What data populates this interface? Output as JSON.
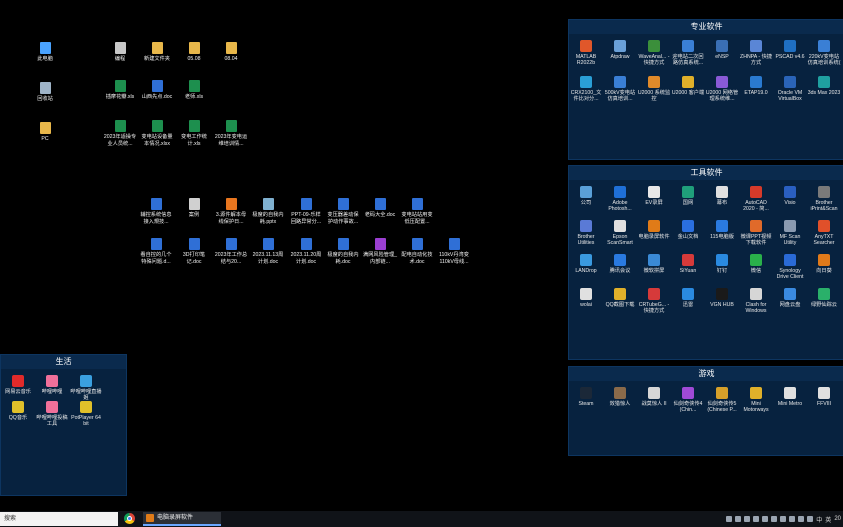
{
  "desktop_icons": [
    {
      "label": "此电脑",
      "icon": "computer-icon",
      "color": "#4aa3ff"
    },
    {
      "label": "回收站",
      "icon": "recycle-bin-icon",
      "color": "#9fb4c8"
    },
    {
      "label": "PC",
      "icon": "folder-icon",
      "color": "#e8b74a"
    },
    {
      "label": "编程",
      "icon": "shortcut-icon",
      "color": "#c8c8c8"
    },
    {
      "label": "新建文件夹",
      "icon": "folder-icon",
      "color": "#e8b74a"
    },
    {
      "label": "05.08",
      "icon": "folder-icon",
      "color": "#e8b74a"
    },
    {
      "label": "08.04",
      "icon": "folder-icon",
      "color": "#e8b74a"
    },
    {
      "label": "插摩花瓣.xls",
      "icon": "excel-icon",
      "color": "#1d8f4e"
    },
    {
      "label": "山西先点.doc",
      "icon": "word-icon",
      "color": "#2f6fd6"
    },
    {
      "label": "老师.xls",
      "icon": "excel-icon",
      "color": "#1d8f4e"
    },
    {
      "label": "2023年适操专业人员统...",
      "icon": "excel-icon",
      "color": "#1d8f4e"
    },
    {
      "label": "变电站设备量本情况.xlsx",
      "icon": "excel-icon",
      "color": "#1d8f4e"
    },
    {
      "label": "变电工作统计.xls",
      "icon": "excel-icon",
      "color": "#1d8f4e"
    },
    {
      "label": "2023年变电运维培训情...",
      "icon": "excel-icon",
      "color": "#1d8f4e"
    },
    {
      "label": "辅控系统信息接入規技...",
      "icon": "word-icon",
      "color": "#2f6fd6"
    },
    {
      "label": "案例",
      "icon": "file-icon",
      "color": "#d0d0d0"
    },
    {
      "label": "3.源件解本母线保护日...",
      "icon": "ppt-icon",
      "color": "#e8761f"
    },
    {
      "label": "极度的自我内耗.pptx",
      "icon": "image-icon",
      "color": "#7fb0d0"
    },
    {
      "label": "PPT-09-乐样回路异常分...",
      "icon": "word-icon",
      "color": "#2f6fd6"
    },
    {
      "label": "变压器差动保护动作事故...",
      "icon": "word-icon",
      "color": "#2f6fd6"
    },
    {
      "label": "老码大全.doc",
      "icon": "word-icon",
      "color": "#2f6fd6"
    },
    {
      "label": "变电站站用变低压配置...",
      "icon": "word-icon",
      "color": "#2f6fd6"
    },
    {
      "label": "看自控的几个特殊问题.d...",
      "icon": "word-icon",
      "color": "#2f6fd6"
    },
    {
      "label": "3D打印笔记.doc",
      "icon": "word-icon",
      "color": "#2f6fd6"
    },
    {
      "label": "2023年工作总结与20...",
      "icon": "word-icon",
      "color": "#2f6fd6"
    },
    {
      "label": "2023.11.13周计划.doc",
      "icon": "word-icon",
      "color": "#2f6fd6"
    },
    {
      "label": "2023.11.20周计划.doc",
      "icon": "word-icon",
      "color": "#2f6fd6"
    },
    {
      "label": "极度的自我内耗.doc",
      "icon": "word-icon",
      "color": "#2f6fd6"
    },
    {
      "label": "满网风险管理_内部链...",
      "icon": "rar-icon",
      "color": "#9b3fd1"
    },
    {
      "label": "配电自动化技术.doc",
      "icon": "word-icon",
      "color": "#2f6fd6"
    },
    {
      "label": "110kV丹湾变110kV母线...",
      "icon": "word-icon",
      "color": "#2f6fd6"
    }
  ],
  "fences": {
    "professional": {
      "title": "专业软件",
      "items": [
        {
          "label": "MATLAB R2022b",
          "icon": "matlab-icon",
          "color": "#e0572a"
        },
        {
          "label": "Atpdraw",
          "icon": "atpdraw-icon",
          "color": "#6aa0d8"
        },
        {
          "label": "WaveAnal... - 快捷方式",
          "icon": "wave-icon",
          "color": "#3b8f3b"
        },
        {
          "label": "迎电站二次回路仿真系统...",
          "icon": "mail-icon",
          "color": "#3a7fd5"
        },
        {
          "label": "eNSP",
          "icon": "ensp-icon",
          "color": "#3a6fb5"
        },
        {
          "label": "ZHNPA - 快捷方式",
          "icon": "zhnpa-icon",
          "color": "#5a86d6"
        },
        {
          "label": "PSCAD v4.6",
          "icon": "pscad-icon",
          "color": "#1f6fc2"
        },
        {
          "label": "220kV变电站仿真培训系统(",
          "icon": "mail-icon",
          "color": "#3a7fd5"
        },
        {
          "label": "CRX2100_文件比对分...",
          "icon": "crx-icon",
          "color": "#2a9fd6"
        },
        {
          "label": "500kV变电站仿真培训...",
          "icon": "mail-icon",
          "color": "#3a7fd5"
        },
        {
          "label": "U2000 系统监控",
          "icon": "u2000-icon",
          "color": "#e08a2a"
        },
        {
          "label": "U2000 客户端",
          "icon": "u2000-icon",
          "color": "#e0b02a"
        },
        {
          "label": "U2000 网络管理系统维...",
          "icon": "u2000-icon",
          "color": "#8a5ad6"
        },
        {
          "label": "ETAP19.0",
          "icon": "etap-icon",
          "color": "#2a7ad0"
        },
        {
          "label": "Oracle VM VirtualBox",
          "icon": "virtualbox-icon",
          "color": "#2a64b8"
        },
        {
          "label": "3ds Max 2023",
          "icon": "3dsmax-icon",
          "color": "#1fa0a0"
        }
      ]
    },
    "tools": {
      "title": "工具软件",
      "items": [
        {
          "label": "公司",
          "icon": "company-icon",
          "color": "#5aa0d8"
        },
        {
          "label": "Adobe Photosh...",
          "icon": "photoshop-icon",
          "color": "#1f6fd6"
        },
        {
          "label": "EV录屏",
          "icon": "ev-icon",
          "color": "#e8e8e8"
        },
        {
          "label": "国网",
          "icon": "sgcc-icon",
          "color": "#1f9f7a"
        },
        {
          "label": "幕布",
          "icon": "mubu-icon",
          "color": "#e0e0e0"
        },
        {
          "label": "AutoCAD 2020 - 简...",
          "icon": "autocad-icon",
          "color": "#d63a2a"
        },
        {
          "label": "Visio",
          "icon": "visio-icon",
          "color": "#2a5fc0"
        },
        {
          "label": "Brother iPrint&Scan",
          "icon": "brother-icon",
          "color": "#7a7a7a"
        },
        {
          "label": "Brother Utilities",
          "icon": "brother-icon",
          "color": "#5a7ad6"
        },
        {
          "label": "Epson ScanSmart",
          "icon": "epson-icon",
          "color": "#e0e0e0"
        },
        {
          "label": "电脑录屏软件",
          "icon": "recorder-icon",
          "color": "#e07b18"
        },
        {
          "label": "金山文档",
          "icon": "kdocs-icon",
          "color": "#2a6fe0"
        },
        {
          "label": "115电脑版",
          "icon": "115-icon",
          "color": "#2a7ae0"
        },
        {
          "label": "微课PPT视频下载软件",
          "icon": "ppt-video-icon",
          "color": "#e06a2a"
        },
        {
          "label": "MF Scan Utility",
          "icon": "scan-icon",
          "color": "#8a9ab0"
        },
        {
          "label": "AnyTXT Searcher",
          "icon": "anytxt-icon",
          "color": "#e0502a"
        },
        {
          "label": "LANDrop",
          "icon": "landrop-icon",
          "color": "#3a9ae0"
        },
        {
          "label": "腾讯会议",
          "icon": "tencent-meeting-icon",
          "color": "#2a7ae0"
        },
        {
          "label": "微软拼屏",
          "icon": "screen-icon",
          "color": "#3a8ad6"
        },
        {
          "label": "SiYuan",
          "icon": "siyuan-icon",
          "color": "#d63a3a"
        },
        {
          "label": "钉钉",
          "icon": "dingtalk-icon",
          "color": "#2a8ae0"
        },
        {
          "label": "微信",
          "icon": "wechat-icon",
          "color": "#2ab04a"
        },
        {
          "label": "Synology Drive Client",
          "icon": "synology-icon",
          "color": "#2a6ad6"
        },
        {
          "label": "向日葵",
          "icon": "sunflower-icon",
          "color": "#e07a1a"
        },
        {
          "label": "wolai",
          "icon": "wolai-icon",
          "color": "#e0e0e0"
        },
        {
          "label": "QQ截图下载",
          "icon": "qq-icon",
          "color": "#e0b02a"
        },
        {
          "label": "CRTubeG... - 快捷方式",
          "icon": "crtube-icon",
          "color": "#d63a3a"
        },
        {
          "label": "迅雷",
          "icon": "xunlei-icon",
          "color": "#2a8ae0"
        },
        {
          "label": "VGN HUB",
          "icon": "vgn-icon",
          "color": "#1a1a1a"
        },
        {
          "label": "Clash for Windows",
          "icon": "clash-icon",
          "color": "#d6d6d6"
        },
        {
          "label": "网盘云盘",
          "icon": "cloud-icon",
          "color": "#3a8ae0"
        },
        {
          "label": "绿野仙踪云",
          "icon": "cloud-icon",
          "color": "#2ab06a"
        }
      ]
    },
    "games": {
      "title": "游戏",
      "items": [
        {
          "label": "Steam",
          "icon": "steam-icon",
          "color": "#1b2838"
        },
        {
          "label": "效猎惊人",
          "icon": "game-icon",
          "color": "#8a6a4a"
        },
        {
          "label": "战莫惊人 II",
          "icon": "game-icon",
          "color": "#d6d6d6"
        },
        {
          "label": "仙剑奇侠传4 (Chin...",
          "icon": "game-icon",
          "color": "#a04ad6"
        },
        {
          "label": "仙剑奇侠传5 (Chinese P...",
          "icon": "game-icon",
          "color": "#d6a02a"
        },
        {
          "label": "Mini Motorways",
          "icon": "mini-motorways-icon",
          "color": "#e0b02a"
        },
        {
          "label": "Mini Metro",
          "icon": "mini-metro-icon",
          "color": "#e0e0e0"
        },
        {
          "label": "FFVIII",
          "icon": "ffviii-icon",
          "color": "#e0e0e0"
        }
      ]
    },
    "life": {
      "title": "生活",
      "items": [
        {
          "label": "网易云音乐",
          "icon": "netease-music-icon",
          "color": "#e02a2a"
        },
        {
          "label": "哔哩哔哩",
          "icon": "bilibili-icon",
          "color": "#f0709a"
        },
        {
          "label": "哔哩哔哩直播姬",
          "icon": "bilibili-live-icon",
          "color": "#3aa0e0"
        },
        {
          "label": "QQ音乐",
          "icon": "qq-music-icon",
          "color": "#e0c02a"
        },
        {
          "label": "哔哩哔哩投稿工具",
          "icon": "bilibili-upload-icon",
          "color": "#f0709a"
        },
        {
          "label": "PotPlayer 64 bit",
          "icon": "potplayer-icon",
          "color": "#e0c02a"
        }
      ]
    }
  },
  "taskbar": {
    "search_placeholder": "搜索",
    "active_app": "电脑录屏软件",
    "tray_lang": "中",
    "tray_ime": "英",
    "tray_time": "20"
  }
}
